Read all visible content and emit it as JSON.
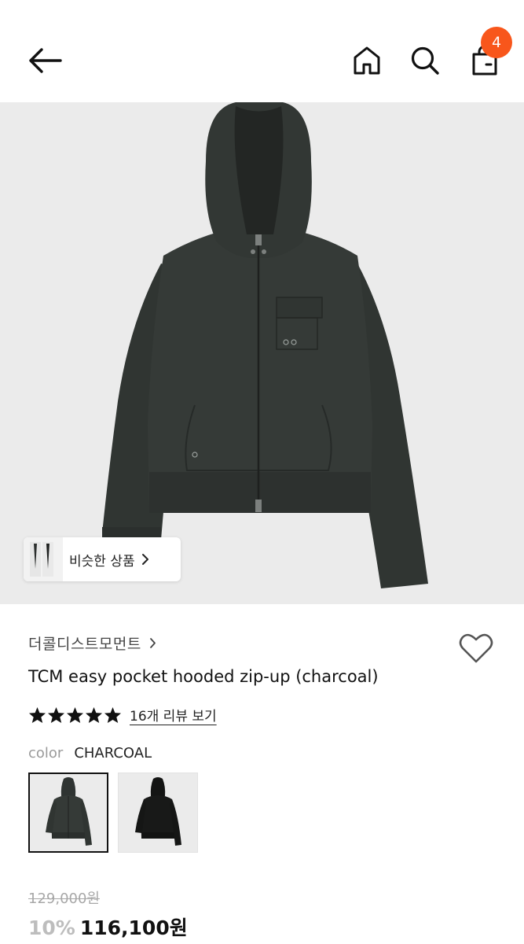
{
  "header": {
    "back_icon": "arrow-left-icon",
    "home_icon": "home-icon",
    "search_icon": "search-icon",
    "cart_icon": "shopping-bag-icon",
    "cart_count": "4",
    "badge_color": "#f8561b"
  },
  "hero": {
    "image": "charcoal-hooded-zip-up-photo",
    "similar_label": "비슷한 상품"
  },
  "product": {
    "brand": "더콜디스트모먼트",
    "title": "TCM easy pocket hooded zip-up (charcoal)",
    "rating_stars": 5,
    "review_link": "16개 리뷰 보기",
    "color_label": "color",
    "color_value": "CHARCOAL",
    "color_options": [
      "charcoal",
      "black"
    ],
    "original_price": "129,000원",
    "discount": "10%",
    "sale_price": "116,100원"
  }
}
